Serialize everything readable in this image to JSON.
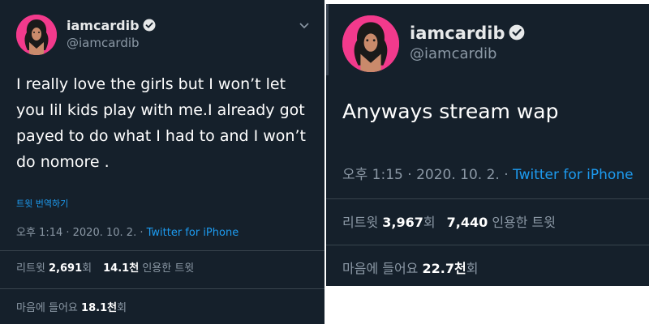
{
  "colors": {
    "background": "#15202b",
    "text": "#ffffff",
    "secondary": "#8b98a5",
    "accent": "#1d9bf0",
    "divider": "#38444d",
    "avatar": "#f23a8c"
  },
  "left_tweet": {
    "display_name": "iamcardib",
    "handle": "@iamcardib",
    "verified_icon": "verified-badge-icon",
    "more_icon": "chevron-down-icon",
    "avatar_icon": "profile-avatar",
    "text": "I really love the girls but I won’t let you lil kids play with me.I already got payed to do what I had to and I won’t do nomore .",
    "translate_link": "트윗 번역하기",
    "time": "오후 1:14 · 2020. 10. 2. · ",
    "source": "Twitter for iPhone",
    "retweets_label": "리트윗",
    "retweets_value": "2,691",
    "retweets_unit": "회",
    "quotes_value": "14.1천",
    "quotes_label": "인용한 트윗",
    "likes_label": "마음에 들어요",
    "likes_value": "18.1천",
    "likes_unit": "회"
  },
  "right_tweet": {
    "display_name": "iamcardib",
    "handle": "@iamcardib",
    "verified_icon": "verified-badge-icon",
    "avatar_icon": "profile-avatar",
    "text": "Anyways stream wap",
    "time": "오후 1:15 · 2020. 10. 2. · ",
    "source": "Twitter for iPhone",
    "retweets_label": "리트윗",
    "retweets_value": "3,967",
    "retweets_unit": "회",
    "quotes_value": "7,440",
    "quotes_label": "인용한 트윗",
    "likes_label": "마음에 들어요",
    "likes_value": "22.7천",
    "likes_unit": "회"
  }
}
